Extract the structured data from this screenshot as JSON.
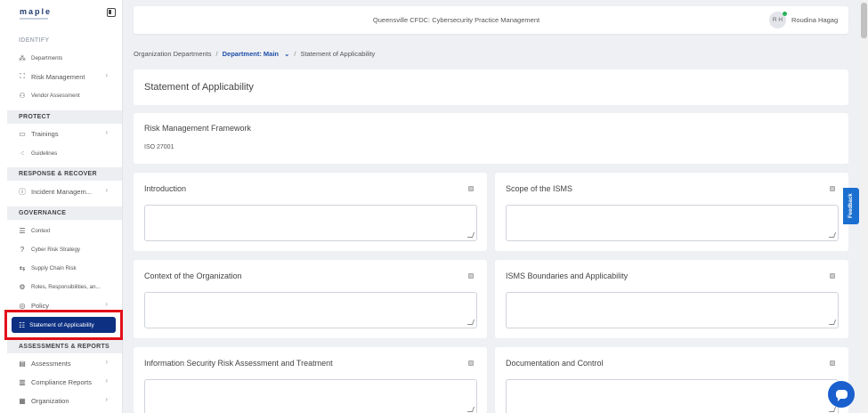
{
  "sidebar": {
    "logo": "maple",
    "sections": {
      "identify": "IDENTIFY",
      "protect": "PROTECT",
      "response": "RESPONSE & RECOVER",
      "governance": "GOVERNANCE",
      "assessments": "ASSESSMENTS & REPORTS"
    },
    "items": {
      "departments": "Departments",
      "risk_management": "Risk Management",
      "vendor_assessment": "Vendor Assessment",
      "trainings": "Trainings",
      "guidelines": "Guidelines",
      "incident_management": "Incident Managem...",
      "context": "Context",
      "cyber_risk_strategy": "Cyber Risk Strategy",
      "supply_chain_risk": "Supply Chain Risk",
      "roles": "Roles, Responsibilities, an...",
      "policy": "Policy",
      "statement_of_applicability": "Statement of Applicability",
      "assessments": "Assessments",
      "compliance_reports": "Compliance Reports",
      "organization": "Organization"
    }
  },
  "header": {
    "title": "Queensville CFDC: Cybersecurity Practice Management",
    "avatar_initials": "R H",
    "user_name": "Roudina Hagag"
  },
  "breadcrumb": {
    "org_departments": "Organization Departments",
    "department": "Department: Main",
    "current": "Statement of Applicability"
  },
  "page": {
    "title": "Statement of Applicability",
    "framework_label": "Risk Management Framework",
    "framework_value": "ISO 27001"
  },
  "sections": {
    "introduction": "Introduction",
    "scope": "Scope of the ISMS",
    "context": "Context of the Organization",
    "boundaries": "ISMS Boundaries and Applicability",
    "risk_assessment": "Information Security Risk Assessment and Treatment",
    "documentation": "Documentation and Control"
  },
  "feedback_label": "Feedback",
  "colors": {
    "active_nav": "#0d3082",
    "highlight": "#e3101a",
    "feedback": "#1b6fd0"
  }
}
